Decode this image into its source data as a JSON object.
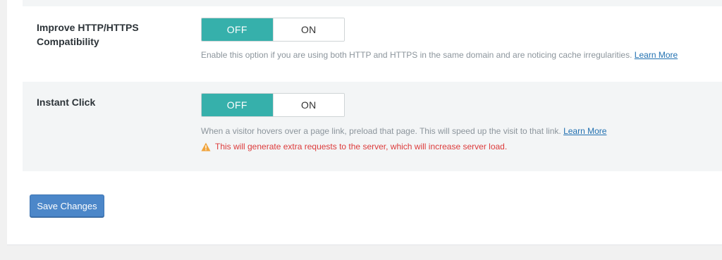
{
  "settings": [
    {
      "label": "Improve HTTP/HTTPS Compatibility",
      "toggle": {
        "off_label": "OFF",
        "on_label": "ON",
        "selected": "OFF"
      },
      "description": "Enable this option if you are using both HTTP and HTTPS in the same domain and are noticing cache irregularities.",
      "link_label": "Learn More"
    },
    {
      "label": "Instant Click",
      "toggle": {
        "off_label": "OFF",
        "on_label": "ON",
        "selected": "OFF"
      },
      "description": "When a visitor hovers over a page link, preload that page. This will speed up the visit to that link.",
      "link_label": "Learn More",
      "warning": "This will generate extra requests to the server, which will increase server load."
    }
  ],
  "save_button": {
    "label": "Save Changes"
  },
  "colors": {
    "toggle_active": "#36b0ab",
    "link": "#2271b1",
    "warning": "#dd3b3b",
    "save_button": "#4c87c9"
  },
  "icons": {
    "warning": "warning-triangle-icon"
  }
}
